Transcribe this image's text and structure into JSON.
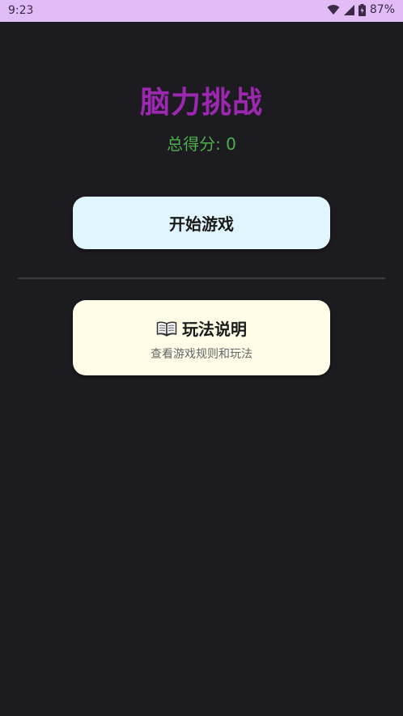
{
  "status_bar": {
    "time": "9:23",
    "battery": "87%",
    "icons": [
      "wifi-icon",
      "cell-signal-icon",
      "battery-icon"
    ]
  },
  "header": {
    "title": "脑力挑战",
    "score_label": "总得分: 0"
  },
  "main": {
    "start_button_label": "开始游戏",
    "rules_card": {
      "icon": "book-icon",
      "title": "玩法说明",
      "subtitle": "查看游戏规则和玩法"
    }
  },
  "colors": {
    "background": "#1c1b1f",
    "status_bar": "#e1bcf7",
    "title": "#9c27b0",
    "score": "#4caf50",
    "start_button": "#e1f5fe",
    "rules_card": "#fffde7"
  }
}
